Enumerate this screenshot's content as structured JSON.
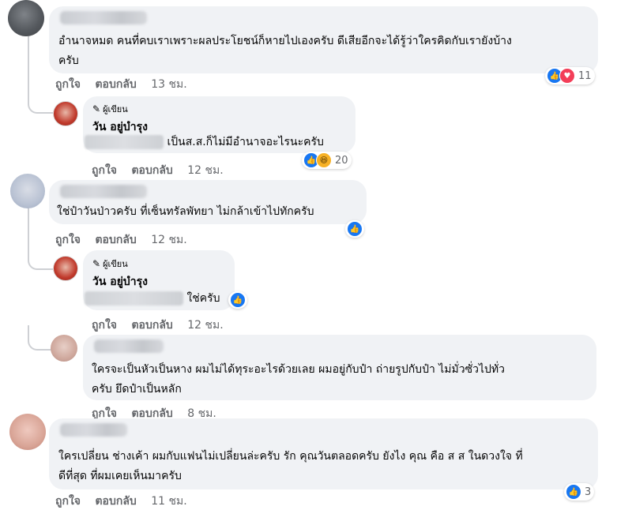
{
  "colors": {
    "like": "#1877f2",
    "love": "#f33e58",
    "haha": "#f7b125",
    "bubble": "#f0f2f5",
    "meta": "#65676b"
  },
  "actions": {
    "like": "ถูกใจ",
    "reply": "ตอบกลับ"
  },
  "comments": [
    {
      "text_lines": [
        "อำนาจหมด คนที่คบเราเพราะผลประโยชน์ก็หายไปเองครับ ดีเสียอีกจะได้รู้ว่าใครคิดกับเรายังบ้าง",
        "ครับ"
      ],
      "time": "13 ชม.",
      "reactions": [
        "like-icon",
        "love-icon"
      ],
      "count": "11"
    },
    {
      "author_badge": "ผู้เขียน",
      "author": "วัน อยู่บำรุง",
      "text": "เป็นส.ส.ก็ไม่มีอำนาจอะไรนะครับ",
      "time": "12 ชม.",
      "reactions": [
        "like-icon",
        "haha-icon"
      ],
      "count": "20"
    },
    {
      "text_lines": [
        "ใช่ป๋าวันป่าวครับ ที่เซ็นทรัลพัทยา ไม่กล้าเข้าไปทักครับ"
      ],
      "time": "12 ชม.",
      "reactions": [
        "like-icon"
      ],
      "count": ""
    },
    {
      "author_badge": "ผู้เขียน",
      "author": "วัน อยู่บำรุง",
      "text": "ใช่ครับ",
      "time": "12 ชม.",
      "reactions": [
        "like-icon"
      ],
      "count": ""
    },
    {
      "text_lines": [
        "ใครจะเป็นหัวเป็นหาง ผมไม่ได้ทุระอะไรด้วยเลย ผมอยู่กับป๋า ถ่ายรูปกับป๋า ไม่มั่วซั่วไปทั่ว",
        "ครับ ยึดป๋าเป็นหลัก"
      ],
      "time": "8 ชม.",
      "reactions": [],
      "count": ""
    },
    {
      "text_lines": [
        "ใครเปลี่ยน ช่างเค้า ผมกับแฟนไม่เปลี่ยนล่ะครับ รัก คุณวันตลอดครับ ยังไง คุณ คือ ส ส ในดวงใจ ที่",
        "ดีที่สุด ที่ผมเคยเห็นมาครับ"
      ],
      "time": "11 ชม.",
      "reactions": [
        "like-icon"
      ],
      "count": "3"
    }
  ]
}
